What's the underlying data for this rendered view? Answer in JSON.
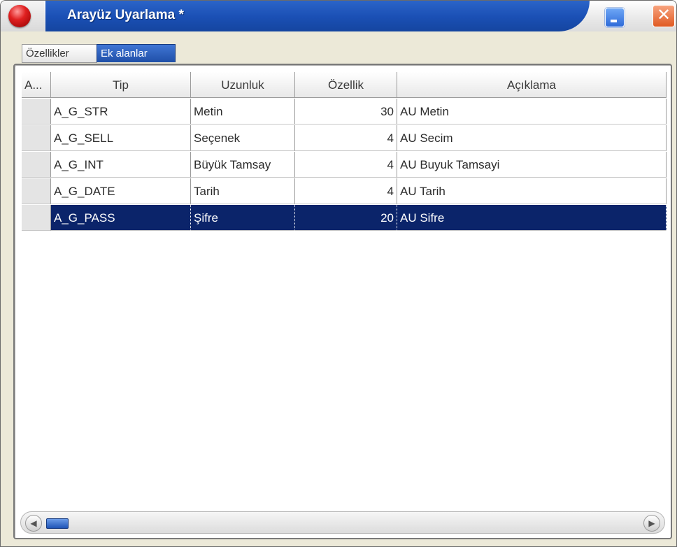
{
  "window": {
    "title": "Arayüz Uyarlama *",
    "close_glyph": "✕"
  },
  "tabs": [
    {
      "label": "Özellikler",
      "active": false
    },
    {
      "label": "Ek alanlar",
      "active": true
    }
  ],
  "grid": {
    "columns": [
      "A...",
      "Tip",
      "Uzunluk",
      "Özellik",
      "Açıklama"
    ],
    "rows": [
      {
        "tip": "A_G_STR",
        "uzunluk": "Metin",
        "ozellik": "30",
        "aciklama": "AU Metin",
        "selected": false
      },
      {
        "tip": "A_G_SELL",
        "uzunluk": "Seçenek",
        "ozellik": "4",
        "aciklama": "AU Secim",
        "selected": false
      },
      {
        "tip": "A_G_INT",
        "uzunluk": "Büyük Tamsay",
        "ozellik": "4",
        "aciklama": "AU Buyuk Tamsayi",
        "selected": false
      },
      {
        "tip": "A_G_DATE",
        "uzunluk": "Tarih",
        "ozellik": "4",
        "aciklama": "AU Tarih",
        "selected": false
      },
      {
        "tip": "A_G_PASS",
        "uzunluk": "Şifre",
        "ozellik": "20",
        "aciklama": "AU Sifre",
        "selected": true
      }
    ]
  },
  "scrollbar": {
    "left_glyph": "◀",
    "right_glyph": "▶",
    "position_fraction": 0.0
  },
  "colors": {
    "title_bar": "#1a4fb4",
    "selection": "#0b246a",
    "close_button": "#e05a22"
  }
}
